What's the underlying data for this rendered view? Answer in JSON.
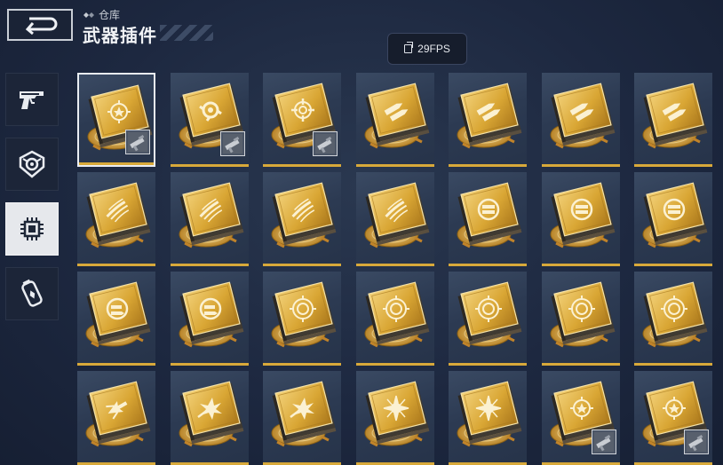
{
  "header": {
    "breadcrumb": "仓库",
    "title": "武器插件",
    "fps": "29FPS"
  },
  "sidebar": {
    "items": [
      {
        "icon": "pistol-icon",
        "active": false
      },
      {
        "icon": "shield-core-icon",
        "active": false
      },
      {
        "icon": "chip-icon",
        "active": true
      },
      {
        "icon": "canister-icon",
        "active": false
      }
    ]
  },
  "grid": {
    "columns": 7,
    "rows": 4,
    "selected_index": 0,
    "items": [
      {
        "symbol": "crosshair-star",
        "badge": "weapon-thumbnail"
      },
      {
        "symbol": "circle-swirl",
        "badge": "weapon-thumbnail"
      },
      {
        "symbol": "reticle",
        "badge": "weapon-thumbnail"
      },
      {
        "symbol": "bullets",
        "badge": null
      },
      {
        "symbol": "bullets",
        "badge": null
      },
      {
        "symbol": "bullets",
        "badge": null
      },
      {
        "symbol": "bullets",
        "badge": null
      },
      {
        "symbol": "streak",
        "badge": null
      },
      {
        "symbol": "streak",
        "badge": null
      },
      {
        "symbol": "streak",
        "badge": null
      },
      {
        "symbol": "streak",
        "badge": null
      },
      {
        "symbol": "magazine",
        "badge": null
      },
      {
        "symbol": "magazine",
        "badge": null
      },
      {
        "symbol": "magazine",
        "badge": null
      },
      {
        "symbol": "magazine-arrow",
        "badge": null
      },
      {
        "symbol": "magazine-arrow",
        "badge": null
      },
      {
        "symbol": "ring",
        "badge": null
      },
      {
        "symbol": "ring",
        "badge": null
      },
      {
        "symbol": "ring",
        "badge": null
      },
      {
        "symbol": "ring",
        "badge": null
      },
      {
        "symbol": "ring",
        "badge": null
      },
      {
        "symbol": "burst-arrow",
        "badge": null
      },
      {
        "symbol": "burst",
        "badge": null
      },
      {
        "symbol": "burst",
        "badge": null
      },
      {
        "symbol": "starburst",
        "badge": null
      },
      {
        "symbol": "starburst",
        "badge": null
      },
      {
        "symbol": "crosshair-star",
        "badge": "weapon-thumbnail"
      },
      {
        "symbol": "crosshair-star",
        "badge": "weapon-thumbnail"
      }
    ]
  },
  "colors": {
    "gold": "#d8a93a",
    "gold_light": "#f0cd6a",
    "gold_dark": "#a9781c",
    "background": "#1d2840",
    "cell": "#2c3a52"
  }
}
